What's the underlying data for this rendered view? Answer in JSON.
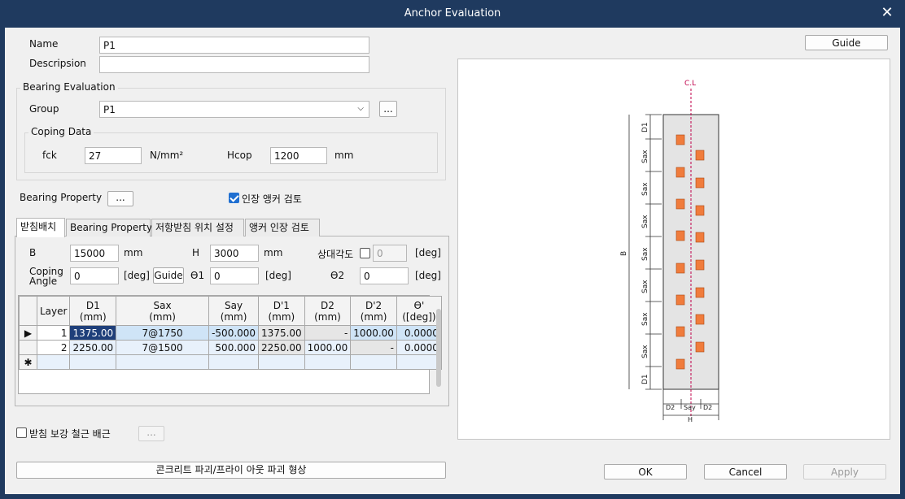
{
  "window": {
    "title": "Anchor Evaluation"
  },
  "top_right_guide": "Guide",
  "fields": {
    "name_label": "Name",
    "name_value": "P1",
    "description_label": "Descripsion",
    "description_value": ""
  },
  "bearing_eval": {
    "title": "Bearing Evaluation",
    "group_label": "Group",
    "group_value": "P1",
    "group_more": "...",
    "coping": {
      "title": "Coping Data",
      "fck_label": "fck",
      "fck_value": "27",
      "fck_unit": "N/mm²",
      "hcop_label": "Hcop",
      "hcop_value": "1200",
      "hcop_unit": "mm"
    }
  },
  "bearing_property": {
    "label": "Bearing Property",
    "button": "..."
  },
  "tension_check": {
    "label": "인장 앵커 검토",
    "checked": true
  },
  "tabs": [
    "받침배치",
    "Bearing Property",
    "저항받침 위치 설정",
    "앵커 인장 검토"
  ],
  "layout_tab": {
    "b_label": "B",
    "b_value": "15000",
    "b_unit": "mm",
    "h_label": "H",
    "h_value": "3000",
    "h_unit": "mm",
    "rel_angle_label": "상대각도",
    "rel_angle_value": "0",
    "rel_angle_unit": "[deg]",
    "coping_angle_label_1": "Coping",
    "coping_angle_label_2": "Angle",
    "coping_angle_value": "0",
    "coping_angle_unit": "[deg]",
    "guide_button": "Guide",
    "theta1_label": "ϴ1",
    "theta1_value": "0",
    "theta1_unit": "[deg]",
    "theta2_label": "ϴ2",
    "theta2_value": "0",
    "theta2_unit": "[deg]"
  },
  "table": {
    "headers": [
      {
        "l1": "Layer",
        "l2": ""
      },
      {
        "l1": "D1",
        "l2": "(mm)"
      },
      {
        "l1": "Sax",
        "l2": "(mm)"
      },
      {
        "l1": "Say",
        "l2": "(mm)"
      },
      {
        "l1": "D'1",
        "l2": "(mm)"
      },
      {
        "l1": "D2",
        "l2": "(mm)"
      },
      {
        "l1": "D'2",
        "l2": "(mm)"
      },
      {
        "l1": "ϴ'",
        "l2": "([deg])"
      }
    ],
    "rows": [
      [
        "1",
        "1375.00",
        "7@1750",
        "-500.000",
        "1375.00",
        "-",
        "1000.00",
        "0.0000"
      ],
      [
        "2",
        "2250.00",
        "7@1500",
        "500.000",
        "2250.00",
        "1000.00",
        "-",
        "0.0000"
      ]
    ],
    "new_row_marker": "✱",
    "current_row_marker": "▶"
  },
  "reinforce": {
    "label": "받침 보강 철근 배근",
    "checked": false,
    "button": "..."
  },
  "bottom": {
    "concrete_button": "콘크리트 파괴/프라이 아웃 파괴 형상",
    "ok": "OK",
    "cancel": "Cancel",
    "apply": "Apply"
  },
  "drawing": {
    "cl_label": "C.L",
    "b_label": "B",
    "h_label": "H",
    "d1_label": "D1",
    "sax_label": "Sax",
    "d2_label": "D2",
    "say_label": "Say",
    "anchor_color": "#f07c3c",
    "cl_color": "#c0004a"
  }
}
